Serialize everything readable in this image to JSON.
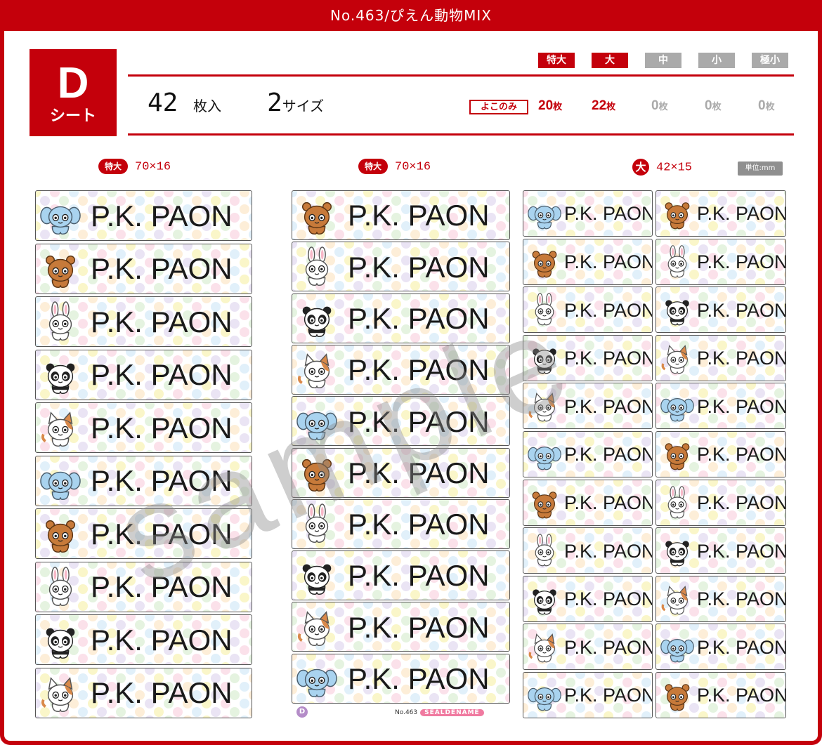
{
  "header": {
    "title": "No.463/ぴえん動物MIX"
  },
  "sheet": {
    "letter": "D",
    "word": "シート"
  },
  "count": {
    "number": "42",
    "unit": "枚入",
    "sizes_number": "2",
    "sizes_unit": "サイズ"
  },
  "size_buttons": [
    {
      "label": "特大",
      "color": "#c4000b"
    },
    {
      "label": "大",
      "color": "#c4000b"
    },
    {
      "label": "中",
      "color": "#aaaaaa"
    },
    {
      "label": "小",
      "color": "#aaaaaa"
    },
    {
      "label": "極小",
      "color": "#aaaaaa"
    }
  ],
  "yoko": {
    "label": "よこのみ"
  },
  "quantities": [
    {
      "num": "20",
      "unit": "枚",
      "color": "#c4000b"
    },
    {
      "num": "22",
      "unit": "枚",
      "color": "#c4000b"
    },
    {
      "num": "0",
      "unit": "枚",
      "color": "#aaaaaa"
    },
    {
      "num": "0",
      "unit": "枚",
      "color": "#aaaaaa"
    },
    {
      "num": "0",
      "unit": "枚",
      "color": "#aaaaaa"
    }
  ],
  "columns": [
    {
      "badge": "特大",
      "dims": "70×16"
    },
    {
      "badge": "特大",
      "dims": "70×16"
    },
    {
      "badge": "大",
      "dims": "42×15"
    }
  ],
  "unit_note": "単位:mm",
  "label_text": "P.K. PAON",
  "watermark": "sample",
  "footer": {
    "badge": "D",
    "code": "No.463",
    "brand": "SEALDENAME"
  },
  "sequences": {
    "col1": [
      "elephant",
      "bear",
      "rabbit",
      "panda",
      "cat",
      "elephant",
      "bear",
      "rabbit",
      "panda",
      "cat"
    ],
    "col2": [
      "bear",
      "rabbit",
      "panda",
      "cat",
      "elephant",
      "bear",
      "rabbit",
      "panda",
      "cat",
      "elephant"
    ],
    "col3a": [
      "elephant",
      "bear",
      "rabbit",
      "panda",
      "cat",
      "elephant",
      "bear",
      "rabbit",
      "panda",
      "cat",
      "elephant"
    ],
    "col3b": [
      "bear",
      "rabbit",
      "panda",
      "cat",
      "elephant",
      "bear",
      "rabbit",
      "panda",
      "cat",
      "elephant",
      "bear"
    ]
  },
  "colors": {
    "accent": "#c4000b",
    "inactive": "#aaaaaa",
    "elephant": "#a9d3ef",
    "bear": "#c77a3a",
    "panda": "#222222",
    "cat_patch": "#d9894a"
  }
}
